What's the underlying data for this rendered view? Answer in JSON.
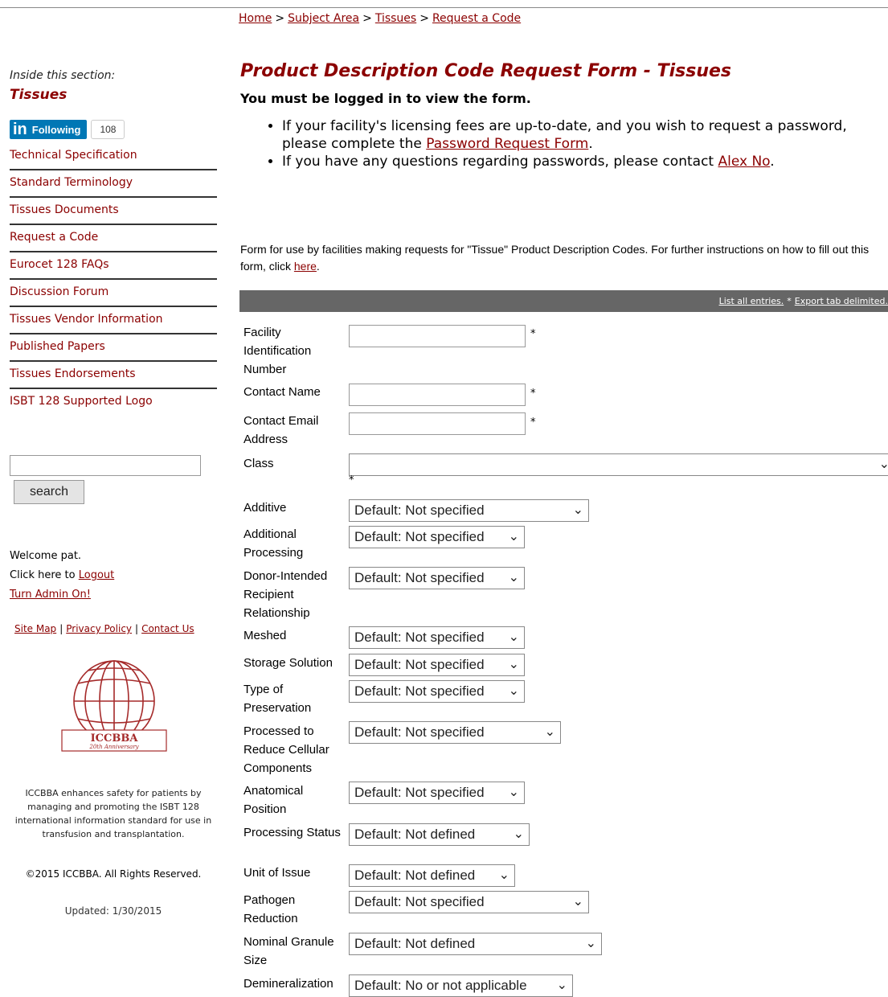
{
  "breadcrumb": {
    "items": [
      "Home",
      "Subject Area",
      "Tissues",
      "Request a Code"
    ],
    "separator": ">"
  },
  "sidebar": {
    "inside_label": "Inside this section:",
    "section_title": "Tissues",
    "linkedin": {
      "button_label": "Following",
      "logo_text": "in",
      "count": "108"
    },
    "nav_items": [
      "Technical Specification",
      "Standard Terminology",
      "Tissues Documents",
      "Request a Code",
      "Eurocet 128 FAQs",
      "Discussion Forum",
      "Tissues Vendor Information",
      "Published Papers",
      "Tissues Endorsements",
      "ISBT 128 Supported Logo"
    ],
    "search_button": "search",
    "welcome": "Welcome pat.",
    "logout_prefix": "Click here to",
    "logout_link": "Logout",
    "admin_link": "Turn Admin On!",
    "footer_links": [
      "Site Map",
      "Privacy Policy",
      "Contact Us"
    ],
    "logo": {
      "name": "ICCBBA",
      "subtitle": "20th Anniversary"
    },
    "about": "ICCBBA enhances safety for patients by managing and promoting the ISBT 128 international information standard for use in transfusion and transplantation.",
    "copyright": "©2015 ICCBBA. All Rights Reserved.",
    "updated": "Updated: 1/30/2015"
  },
  "main": {
    "title": "Product Description Code Request Form - Tissues",
    "login_msg": "You must be logged in to view the form.",
    "bullet1_text": "If your facility's licensing fees are up-to-date, and you wish to request a password, please complete the",
    "bullet1_link": "Password Request Form",
    "bullet1_end": ".",
    "bullet2_text": "If you have any questions regarding passwords, please contact",
    "bullet2_link": "Alex No",
    "bullet2_end": ".",
    "intro_text": "Form for use by facilities making requests for \"Tissue\" Product Description Codes. For further instructions on how to fill out this form, click",
    "intro_link": "here",
    "intro_end": "."
  },
  "toolbar": {
    "list_all": "List all entries.",
    "separator": "*",
    "export": "Export tab delimited."
  },
  "form": {
    "required_mark": "*",
    "fields": [
      {
        "label": "Facility Identification Number",
        "type": "text"
      },
      {
        "label": "Contact Name",
        "type": "text"
      },
      {
        "label": "Contact Email Address",
        "type": "text"
      },
      {
        "label": "Class",
        "type": "select",
        "value": ""
      },
      {
        "label": "Additive",
        "type": "select",
        "value": "Default: Not specified"
      },
      {
        "label": "Additional Processing",
        "type": "select",
        "value": "Default: Not specified"
      },
      {
        "label": "Donor-Intended Recipient Relationship",
        "type": "select",
        "value": "Default: Not specified"
      },
      {
        "label": "Meshed",
        "type": "select",
        "value": "Default: Not specified"
      },
      {
        "label": "Storage Solution",
        "type": "select",
        "value": "Default: Not specified"
      },
      {
        "label": "Type of Preservation",
        "type": "select",
        "value": "Default: Not specified"
      },
      {
        "label": "Processed to Reduce Cellular Components",
        "type": "select",
        "value": "Default: Not specified"
      },
      {
        "label": "Anatomical Position",
        "type": "select",
        "value": "Default: Not specified"
      },
      {
        "label": "Processing Status",
        "type": "select",
        "value": "Default: Not defined"
      },
      {
        "label": "Unit of Issue",
        "type": "select",
        "value": "Default: Not defined"
      },
      {
        "label": "Pathogen Reduction",
        "type": "select",
        "value": "Default: Not specified"
      },
      {
        "label": "Nominal Granule Size",
        "type": "select",
        "value": "Default: Not defined"
      },
      {
        "label": "Demineralization",
        "type": "select",
        "value": "Default: No or not applicable"
      }
    ]
  },
  "colors": {
    "accent": "#8b0000",
    "linkedin": "#0077b5",
    "bar": "#666666"
  }
}
